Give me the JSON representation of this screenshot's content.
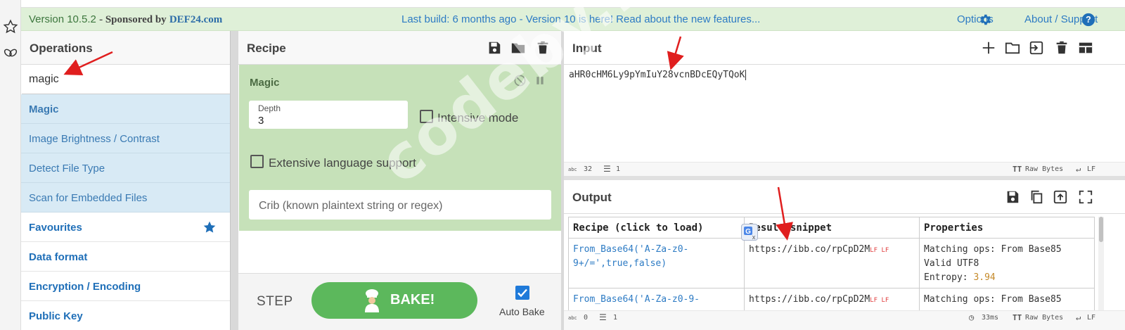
{
  "banner": {
    "version": "Version 10.5.2",
    "sponsored_by": "Sponsored by",
    "sponsor": "DEF24.com",
    "last_build": "Last build: 6 months ago - Version 10 is here! Read about the new features...",
    "options": "Options",
    "about": "About / Support"
  },
  "operations": {
    "title": "Operations",
    "search_value": "magic",
    "results": [
      "Magic",
      "Image Brightness / Contrast",
      "Detect File Type",
      "Scan for Embedded Files"
    ],
    "categories": [
      "Favourites",
      "Data format",
      "Encryption / Encoding",
      "Public Key"
    ]
  },
  "recipe": {
    "title": "Recipe",
    "operation": "Magic",
    "depth_label": "Depth",
    "depth_value": "3",
    "intensive_label": "Intensive mode",
    "extensive_label": "Extensive language support",
    "crib_placeholder": "Crib (known plaintext string or regex)",
    "step_label": "STEP",
    "bake_label": "BAKE!",
    "auto_bake_label": "Auto Bake",
    "auto_bake_checked": true
  },
  "input": {
    "title": "Input",
    "text": "aHR0cHM6Ly9pYmIuY28vcnBDcEQyTQoK",
    "status_chars": "32",
    "status_lines": "1",
    "status_encoding": "Raw Bytes",
    "status_eol": "LF"
  },
  "output": {
    "title": "Output",
    "headers": [
      "Recipe (click to load)",
      "Result snippet",
      "Properties"
    ],
    "rows": [
      {
        "recipe_line1": "From_Base64('A-Za-z0-",
        "recipe_line2": "9+/=',true,false)",
        "snippet": "https://ibb.co/rpCpD2M",
        "snippet_marks": "LF LF",
        "prop1": "Matching ops: From Base85",
        "prop2": "Valid UTF8",
        "prop3_label": "Entropy: ",
        "prop3_value": "3.94"
      },
      {
        "recipe_line1": "From_Base64('A-Za-z0-9-",
        "snippet": "https://ibb.co/rpCpD2M",
        "snippet_marks": "LF LF",
        "prop1": "Matching ops: From Base85"
      }
    ],
    "status_chars": "0",
    "status_lines": "1",
    "status_time": "33ms",
    "status_encoding": "Raw Bytes",
    "status_eol": "LF"
  },
  "watermark": "codeby.net",
  "colors": {
    "banner_bg": "#dff0d8",
    "recipe_card_bg": "#c6e1b9",
    "op_result_bg": "#d8eaf5",
    "bake_green": "#5cb85c",
    "link_blue": "#2d7bc4",
    "arrow_red": "#e01e1e"
  }
}
